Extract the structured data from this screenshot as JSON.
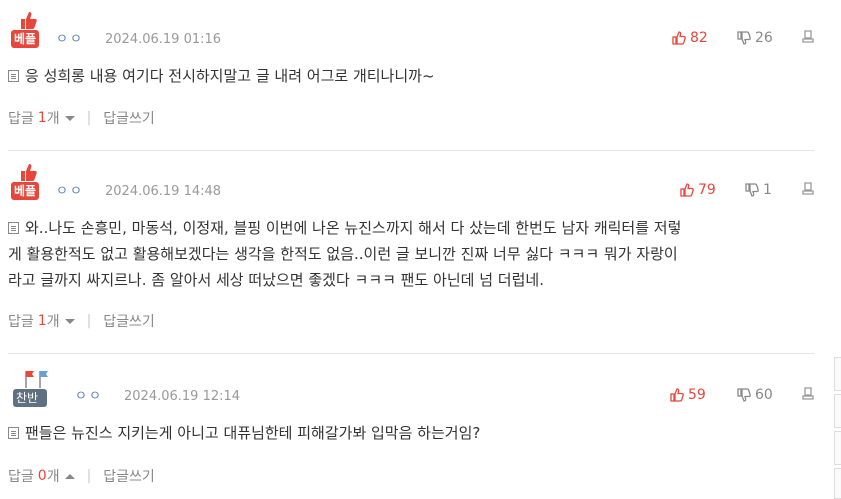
{
  "comments": [
    {
      "badge": "베플",
      "nick": "ㅇㅇ",
      "date": "2024.06.19 01:16",
      "up": "82",
      "down": "26",
      "body": "응 성희롱 내용 여기다 전시하지말고 글 내려 어그로 개티나니까~",
      "reply_label": "답글",
      "reply_count": "1",
      "reply_unit": "개",
      "write_label": "답글쓰기"
    },
    {
      "badge": "베플",
      "nick": "ㅇㅇ",
      "date": "2024.06.19 14:48",
      "up": "79",
      "down": "1",
      "body_lines": [
        "와..나도 손흥민, 마동석, 이정재, 블핑 이번에 나온 뉴진스까지 해서 다 샀는데 한번도 남자 캐릭터를 저렇",
        "게 활용한적도 없고 활용해보겠다는 생각을 한적도 없음..이런 글 보니깐 진짜 너무 싫다 ㅋㅋㅋ 뭐가 자랑이",
        "라고 글까지 싸지르나. 좀 알아서 세상 떠났으면 좋겠다 ㅋㅋㅋ 팬도 아닌데 넘 더럽네."
      ],
      "reply_label": "답글",
      "reply_count": "1",
      "reply_unit": "개",
      "write_label": "답글쓰기"
    },
    {
      "badge": "찬반대결",
      "nick": "ㅇㅇ",
      "date": "2024.06.19 12:14",
      "up": "59",
      "down": "60",
      "body": "팬들은 뉴진스 지키는게 아니고 대퓨님한테 피해갈가봐 입막음 하는거임?",
      "reply_label": "답글",
      "reply_count": "0",
      "reply_unit": "개",
      "write_label": "답글쓰기"
    }
  ],
  "colors": {
    "accent": "#e8463a",
    "nick": "#5b7fb8",
    "muted": "#999999"
  }
}
